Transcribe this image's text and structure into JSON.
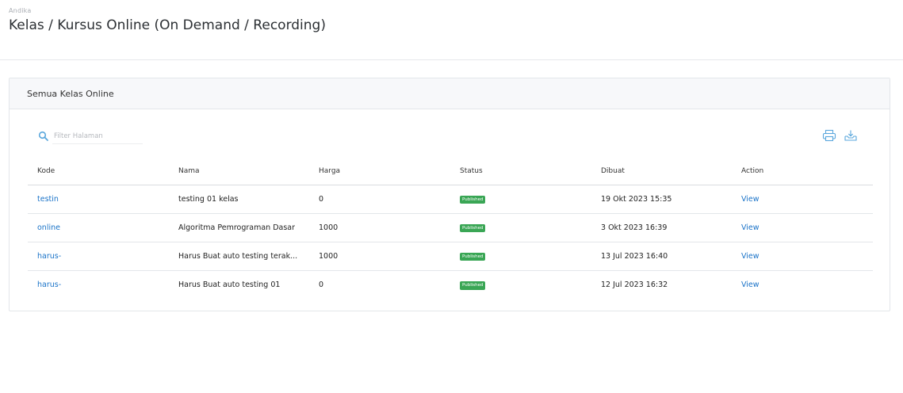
{
  "header": {
    "breadcrumb": "Andika",
    "title": "Kelas / Kursus Online (On Demand / Recording)"
  },
  "card": {
    "title": "Semua Kelas Online",
    "search": {
      "placeholder": "Filter Halaman",
      "value": ""
    },
    "toolbar": {
      "print_icon": "print-icon",
      "download_icon": "download-icon"
    }
  },
  "table": {
    "columns": [
      "Kode",
      "Nama",
      "Harga",
      "Status",
      "Dibuat",
      "Action"
    ],
    "rows": [
      {
        "kode": "testin",
        "nama": "testing 01 kelas",
        "harga": "0",
        "status": "Published",
        "dibuat": "19 Okt 2023 15:35",
        "action": "View"
      },
      {
        "kode": "online",
        "nama": "Algoritma Pemrograman Dasar",
        "harga": "1000",
        "status": "Published",
        "dibuat": "3 Okt 2023 16:39",
        "action": "View"
      },
      {
        "kode": "harus-",
        "nama": "Harus Buat auto testing terak...",
        "harga": "1000",
        "status": "Published",
        "dibuat": "13 Jul 2023 16:40",
        "action": "View"
      },
      {
        "kode": "harus-",
        "nama": "Harus Buat auto testing 01",
        "harga": "0",
        "status": "Published",
        "dibuat": "12 Jul 2023 16:32",
        "action": "View"
      }
    ]
  },
  "colors": {
    "link": "#1a73c8",
    "badge": "#3aa655",
    "icon": "#5aa7dc"
  }
}
